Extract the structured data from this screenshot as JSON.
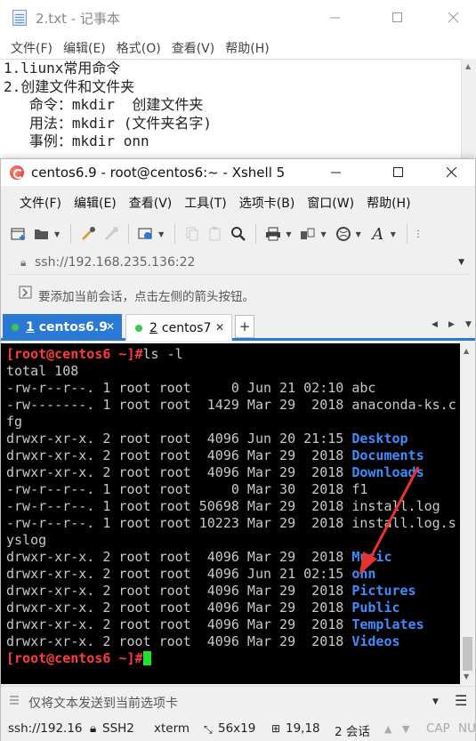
{
  "notepad": {
    "title": "2.txt - 记事本",
    "menu": [
      "文件(F)",
      "编辑(E)",
      "格式(O)",
      "查看(V)",
      "帮助(H)"
    ],
    "lines": [
      "1.liunx常用命令",
      "2.创建文件和文件夹",
      "   命令：mkdir  创建文件夹",
      "   用法：mkdir (文件夹名字)",
      "   事例：mkdir onn"
    ]
  },
  "xshell": {
    "title": "centos6.9 - root@centos6:~ - Xshell 5",
    "menu": [
      "文件(F)",
      "编辑(E)",
      "查看(V)",
      "工具(T)",
      "选项卡(B)",
      "窗口(W)",
      "帮助(H)"
    ],
    "address": "ssh://192.168.235.136:22",
    "hint": "要添加当前会话，点击左侧的箭头按钮。",
    "tabs": [
      {
        "num": "1",
        "label": "centos6.9"
      },
      {
        "num": "2",
        "label": "centos7"
      }
    ],
    "terminal": {
      "prompt": "[root@centos6 ~]#",
      "command": "ls -l",
      "total": "total 108",
      "entries": [
        {
          "meta": "-rw-r--r--. 1 root root     0 Jun 21 02:10 ",
          "name": "abc",
          "dir": false
        },
        {
          "meta": "-rw-------. 1 root root  1429 Mar 29  2018 ",
          "name": "anaconda-ks.c",
          "dir": false
        },
        {
          "meta": "",
          "name": "fg",
          "dir": false
        },
        {
          "meta": "drwxr-xr-x. 2 root root  4096 Jun 20 21:15 ",
          "name": "Desktop",
          "dir": true
        },
        {
          "meta": "drwxr-xr-x. 2 root root  4096 Mar 29  2018 ",
          "name": "Documents",
          "dir": true
        },
        {
          "meta": "drwxr-xr-x. 2 root root  4096 Mar 29  2018 ",
          "name": "Downloads",
          "dir": true
        },
        {
          "meta": "-rw-r--r--. 1 root root     0 Mar 30  2018 ",
          "name": "f1",
          "dir": false
        },
        {
          "meta": "-rw-r--r--. 1 root root 50698 Mar 29  2018 ",
          "name": "install.log",
          "dir": false
        },
        {
          "meta": "-rw-r--r--. 1 root root 10223 Mar 29  2018 ",
          "name": "install.log.s",
          "dir": false
        },
        {
          "meta": "",
          "name": "yslog",
          "dir": false
        },
        {
          "meta": "drwxr-xr-x. 2 root root  4096 Mar 29  2018 ",
          "name": "Music",
          "dir": true
        },
        {
          "meta": "drwxr-xr-x. 2 root root  4096 Jun 21 02:15 ",
          "name": "onn",
          "dir": true
        },
        {
          "meta": "drwxr-xr-x. 2 root root  4096 Mar 29  2018 ",
          "name": "Pictures",
          "dir": true
        },
        {
          "meta": "drwxr-xr-x. 2 root root  4096 Mar 29  2018 ",
          "name": "Public",
          "dir": true
        },
        {
          "meta": "drwxr-xr-x. 2 root root  4096 Mar 29  2018 ",
          "name": "Templates",
          "dir": true
        },
        {
          "meta": "drwxr-xr-x. 2 root root  4096 Mar 29  2018 ",
          "name": "Videos",
          "dir": true
        }
      ]
    },
    "send_bar": "仅将文本发送到当前选项卡",
    "status": {
      "connection": "ssh://192.16",
      "protocol": "SSH2",
      "term": "xterm",
      "size": "56x19",
      "cursor": "19,18",
      "sessions": "2 会话",
      "caps": "CAP",
      "num": "NUM"
    },
    "colors": {
      "tab_active": "#2a7ad5",
      "prompt": "#ff3b3b",
      "directory": "#3f8cff",
      "cursor": "#21e12e",
      "annotation_arrow": "#e8322e"
    }
  }
}
